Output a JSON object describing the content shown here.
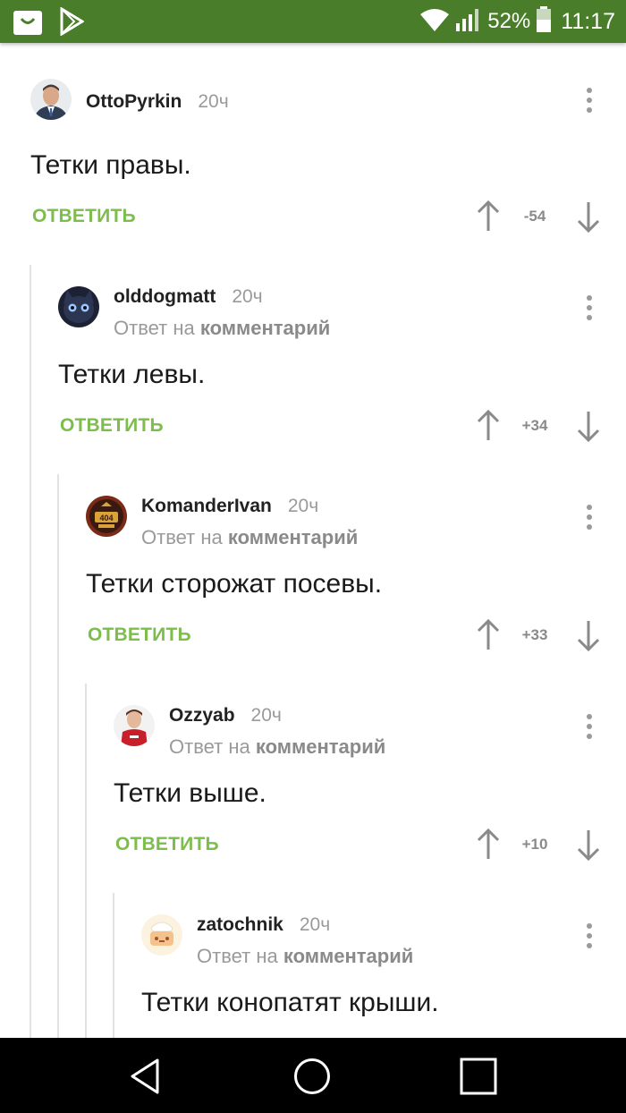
{
  "status_bar": {
    "battery_percent": "52%",
    "time": "11:17",
    "colors": {
      "background": "#4a7d2a"
    },
    "icons": [
      "bag-notification-icon",
      "play-store-icon",
      "wifi-icon",
      "signal-icon",
      "battery-icon"
    ]
  },
  "comments": [
    {
      "author": "OttoPyrkin",
      "time": "20ч",
      "reply_prefix": "",
      "reply_target": "",
      "text": "Тетки правы.",
      "reply_label": "ОТВЕТИТЬ",
      "score": "-54"
    },
    {
      "author": "olddogmatt",
      "time": "20ч",
      "reply_prefix": "Ответ на",
      "reply_target": "комментарий",
      "text": "Тетки левы.",
      "reply_label": "ОТВЕТИТЬ",
      "score": "+34"
    },
    {
      "author": "KomanderIvan",
      "time": "20ч",
      "reply_prefix": "Ответ на",
      "reply_target": "комментарий",
      "text": "Тетки сторожат посевы.",
      "reply_label": "ОТВЕТИТЬ",
      "score": "+33",
      "avatar_text": "404"
    },
    {
      "author": "Ozzyab",
      "time": "20ч",
      "reply_prefix": "Ответ на",
      "reply_target": "комментарий",
      "text": "Тетки выше.",
      "reply_label": "ОТВЕТИТЬ",
      "score": "+10"
    },
    {
      "author": "zatochnik",
      "time": "20ч",
      "reply_prefix": "Ответ на",
      "reply_target": "комментарий",
      "text": "Тетки конопатят крыши.",
      "reply_label": "",
      "score": ""
    }
  ],
  "colors": {
    "reply_green": "#7cbd4b",
    "meta_gray": "#9a9a9a",
    "thread_line": "#e2e2e2"
  },
  "nav_bar": {
    "icons": [
      "back-icon",
      "home-icon",
      "recents-icon"
    ]
  }
}
